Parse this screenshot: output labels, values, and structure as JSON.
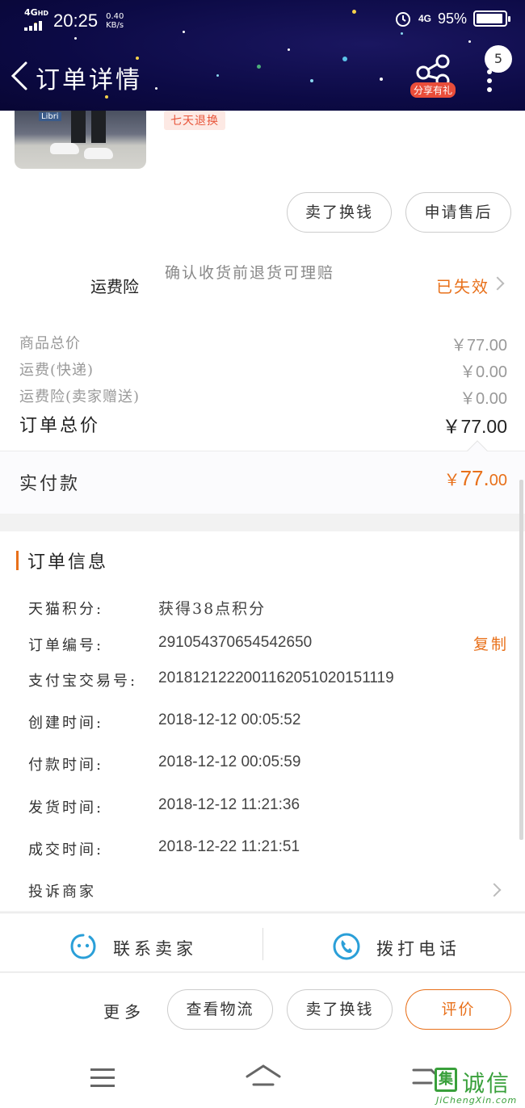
{
  "status_bar": {
    "network": "4G",
    "network_badge": "HD",
    "time": "20:25",
    "speed_value": "0.40",
    "speed_unit": "KB/s",
    "network_right": "4G",
    "battery": "95%"
  },
  "header": {
    "title": "订单详情",
    "share_label": "分享有礼",
    "badge_count": "5"
  },
  "product": {
    "image_sign": "Libri",
    "return_tag": "七天退换",
    "actions": [
      "卖了换钱",
      "申请售后"
    ]
  },
  "insurance": {
    "label": "运费险",
    "description": "确认收货前退货可理赔",
    "status": "已失效"
  },
  "prices": {
    "rows": [
      {
        "label": "商品总价",
        "value": "￥77.00"
      },
      {
        "label": "运费(快递)",
        "value": "￥0.00"
      },
      {
        "label": "运费险(卖家赠送)",
        "value": "￥0.00"
      }
    ],
    "total_label": "订单总价",
    "total_value": "￥77.00",
    "paid_label": "实付款",
    "paid_currency": "￥",
    "paid_integer": "77.",
    "paid_decimal": "00"
  },
  "order_info": {
    "title": "订单信息",
    "rows": [
      {
        "label": "天猫积分:",
        "value": "获得38点积分"
      },
      {
        "label": "订单编号:",
        "value": "291054370654542650"
      },
      {
        "label": "支付宝交易号:",
        "value": "2018121222001162051020151119"
      },
      {
        "label": "创建时间:",
        "value": "2018-12-12 00:05:52"
      },
      {
        "label": "付款时间:",
        "value": "2018-12-12 00:05:59"
      },
      {
        "label": "发货时间:",
        "value": "2018-12-12 11:21:36"
      },
      {
        "label": "成交时间:",
        "value": "2018-12-22 11:21:51"
      }
    ],
    "copy_label": "复制",
    "complaint_label": "投诉商家"
  },
  "contact": {
    "contact_seller": "联系卖家",
    "call_phone": "拨打电话"
  },
  "action_bar": {
    "more": "更多",
    "view_logistics": "查看物流",
    "sell": "卖了换钱",
    "review": "评价"
  },
  "watermark": {
    "box_char": "集",
    "cn": "诚信",
    "en": "JiChengXin.com"
  },
  "colors": {
    "accent": "#e8701a",
    "header_bg": "#0c0a45",
    "share_badge": "#e94d3a"
  }
}
